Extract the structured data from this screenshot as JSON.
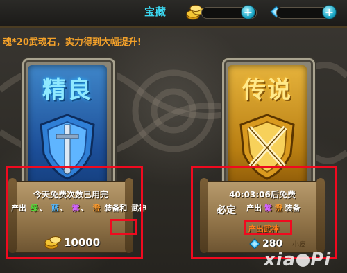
{
  "header": {
    "title": "宝藏",
    "gold_plus": "+",
    "gem_plus": "+"
  },
  "banner": "魂*20武魂石，实力得到大幅提升!",
  "cards": [
    {
      "title": "精良",
      "status": "今天免费次数已用完",
      "production": {
        "prefix": "产出",
        "colors": [
          "绿",
          "蓝",
          "紫",
          "澄"
        ],
        "sep": "、",
        "suffix": "装备和",
        "highlight": "武神"
      },
      "price": "10000",
      "currency_icon": "gold-coins-icon"
    },
    {
      "title": "传说",
      "status": "40:03:06后免费",
      "must": "必定",
      "production": {
        "prefix": "产出",
        "colors": [
          "紫",
          "澄"
        ],
        "suffix": "装备"
      },
      "highlight": "产出武神",
      "price": "280",
      "currency_icon": "blue-gem-icon",
      "tag": "小皮"
    }
  ],
  "watermark": {
    "left": "xia",
    "right": "Pi"
  },
  "colors": {
    "title": "#3cd7f0",
    "banner": "#f3a12a",
    "highlight_box": "#f00a1f"
  }
}
